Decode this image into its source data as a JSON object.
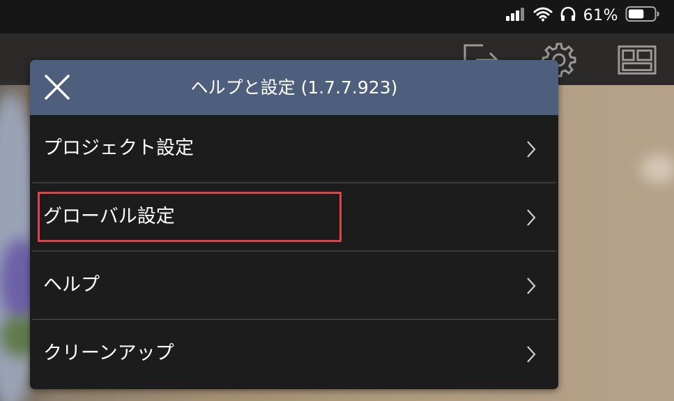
{
  "status_bar": {
    "battery_percent": "61%",
    "battery_level": 0.61,
    "icons": [
      "cellular-signal-icon",
      "wifi-icon",
      "headphones-icon",
      "battery-icon"
    ]
  },
  "toolbar": {
    "icons": [
      "export-icon",
      "settings-gear-icon",
      "layout-icon"
    ]
  },
  "popover": {
    "title": "ヘルプと設定 (1.7.7.923)",
    "close_icon": "close-icon",
    "header_color": "#4d5f7d",
    "items": [
      {
        "label": "プロジェクト設定",
        "icon": "chevron-right-icon"
      },
      {
        "label": "グローバル設定",
        "icon": "chevron-right-icon",
        "highlighted": true
      },
      {
        "label": "ヘルプ",
        "icon": "chevron-right-icon"
      },
      {
        "label": "クリーンアップ",
        "icon": "chevron-right-icon"
      }
    ]
  },
  "colors": {
    "highlight_border": "#e0444a",
    "menu_background": "#1c1c1c",
    "divider": "#3a3a3a"
  }
}
